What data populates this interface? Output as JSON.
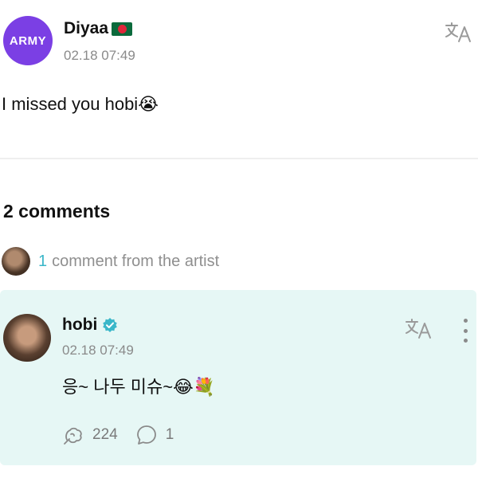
{
  "post": {
    "author_avatar_text": "ARMY",
    "author_name": "Diyaa",
    "author_flag": "bangladesh-flag-icon",
    "timestamp": "02.18 07:49",
    "text": "I missed you hobi😭"
  },
  "comments_section": {
    "title": "2 comments",
    "artist_count": "1",
    "artist_label": "comment from the artist"
  },
  "comment": {
    "author_name": "hobi",
    "verified": true,
    "timestamp": "02.18 07:49",
    "text": "응~ 나두 미슈~😂💐",
    "likes": "224",
    "replies": "1"
  },
  "colors": {
    "army_avatar": "#7b3fe4",
    "accent_teal": "#3ab7c9",
    "comment_bg": "#e6f7f5",
    "muted": "#8a8a8a"
  }
}
